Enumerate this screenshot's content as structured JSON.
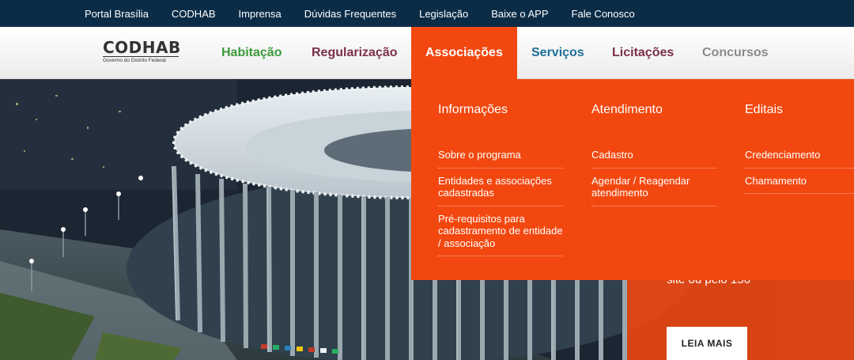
{
  "topbar": {
    "links": [
      "Portal Brasília",
      "CODHAB",
      "Imprensa",
      "Dúvidas Frequentes",
      "Legislação",
      "Baixe o APP",
      "Fale Conosco"
    ]
  },
  "logo": {
    "name": "CODHAB",
    "subtitle": "Governo do Distrito Federal"
  },
  "nav": {
    "items": [
      {
        "label": "Habitação",
        "color": "#3b9a3a"
      },
      {
        "label": "Regularização",
        "color": "#7a2f4a"
      },
      {
        "label": "Associações",
        "color": "#ffffff",
        "active": true
      },
      {
        "label": "Serviços",
        "color": "#1e6f9a"
      },
      {
        "label": "Licitações",
        "color": "#7a2f4a"
      },
      {
        "label": "Concursos",
        "color": "#8a8a8a"
      }
    ]
  },
  "dropdown": {
    "columns": [
      {
        "title": "Informações",
        "items": [
          "Sobre o programa",
          "Entidades e associações cadastradas",
          "Pré-requisitos para cadastramento de entidade / associação"
        ]
      },
      {
        "title": "Atendimento",
        "items": [
          "Cadastro",
          "Agendar / Reagendar atendimento"
        ]
      },
      {
        "title": "Editais",
        "items": [
          "Credenciamento",
          "Chamamento"
        ]
      }
    ]
  },
  "hero": {
    "text": "site ou pelo 156",
    "button": "LEIA MAIS"
  },
  "colors": {
    "accent": "#f24810",
    "topbar": "#0b2c47"
  }
}
